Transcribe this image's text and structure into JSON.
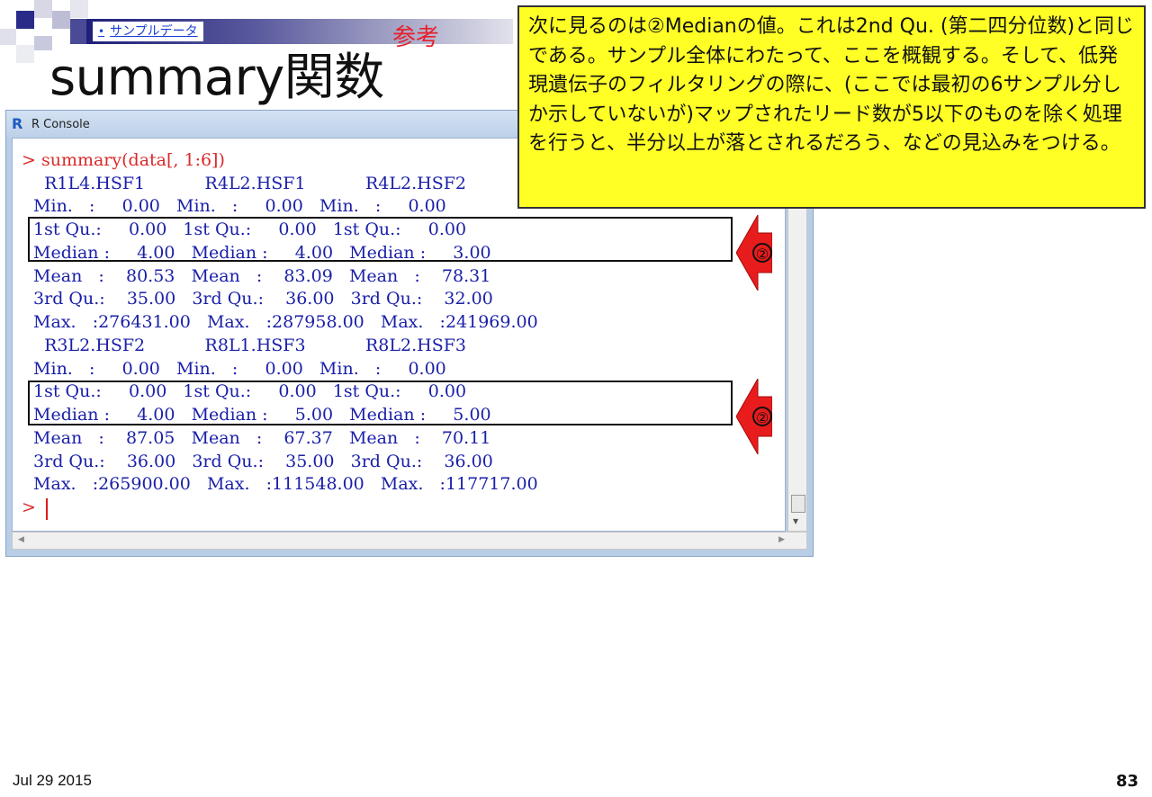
{
  "slide": {
    "link_text": "サンプルデータ",
    "ref_label": "参考",
    "title": "summary関数",
    "callout": "次に見るのは②Medianの値。これは2nd Qu. (第二四分位数)と同じである。サンプル全体にわたって、ここを概観する。そして、低発現遺伝子のフィルタリングの際に、(ここでは最初の6サンプル分しか示していないが)マップされたリード数が5以下のものを除く処理を行うと、半分以上が落とされるだろう、などの見込みをつける。",
    "footer_date": "Jul 29 2015",
    "page_number": "83"
  },
  "window": {
    "title": "R Console",
    "logo": "R"
  },
  "console": {
    "lines": [
      "> summary(data[, 1:6])",
      "   R1L4.HSF1           R4L2.HSF1           R4L2.HSF2",
      " Min.   :     0.00   Min.   :     0.00   Min.   :     0.00",
      " 1st Qu.:     0.00   1st Qu.:     0.00   1st Qu.:     0.00",
      " Median :     4.00   Median :     4.00   Median :     3.00",
      " Mean   :    80.53   Mean   :    83.09   Mean   :    78.31",
      " 3rd Qu.:    35.00   3rd Qu.:    36.00   3rd Qu.:    32.00",
      " Max.   :276431.00   Max.   :287958.00   Max.   :241969.00",
      "   R3L2.HSF2           R8L1.HSF3           R8L2.HSF3",
      " Min.   :     0.00   Min.   :     0.00   Min.   :     0.00",
      " 1st Qu.:     0.00   1st Qu.:     0.00   1st Qu.:     0.00",
      " Median :     4.00   Median :     5.00   Median :     5.00",
      " Mean   :    87.05   Mean   :    67.37   Mean   :    70.11",
      " 3rd Qu.:    36.00   3rd Qu.:    35.00   3rd Qu.:    36.00",
      " Max.   :265900.00   Max.   :111548.00   Max.   :117717.00",
      "> "
    ]
  },
  "markers": {
    "label": "②"
  },
  "colors": {
    "callout_bg": "#ffff26",
    "console_text": "#1a20a8",
    "console_cmd": "#d92a2a",
    "arrow_fill": "#e81c1c"
  }
}
